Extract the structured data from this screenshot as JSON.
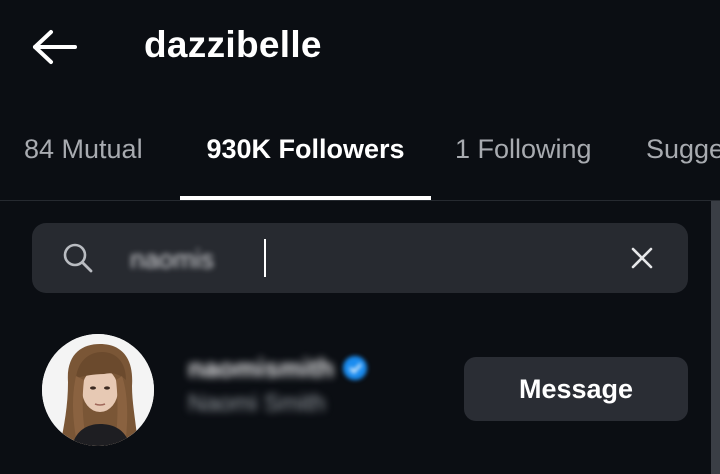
{
  "header": {
    "title": "dazzibelle",
    "back_icon": "arrow-left-icon"
  },
  "tabs": [
    {
      "label": "84 Mutual",
      "active": false
    },
    {
      "label": "930K Followers",
      "active": true
    },
    {
      "label": "1 Following",
      "active": false
    },
    {
      "label": "Sugge",
      "active": false
    }
  ],
  "search": {
    "value": "naomis",
    "search_icon": "search-icon",
    "clear_icon": "close-icon"
  },
  "results": [
    {
      "username": "naomismith",
      "full_name": "Naomi Smith",
      "verified": true,
      "action_label": "Message"
    }
  ],
  "colors": {
    "background": "#0b0e13",
    "surface": "#272a30",
    "button": "#2a2d34",
    "verified": "#1a8cf0",
    "inactive_tab": "#a8abb0"
  }
}
